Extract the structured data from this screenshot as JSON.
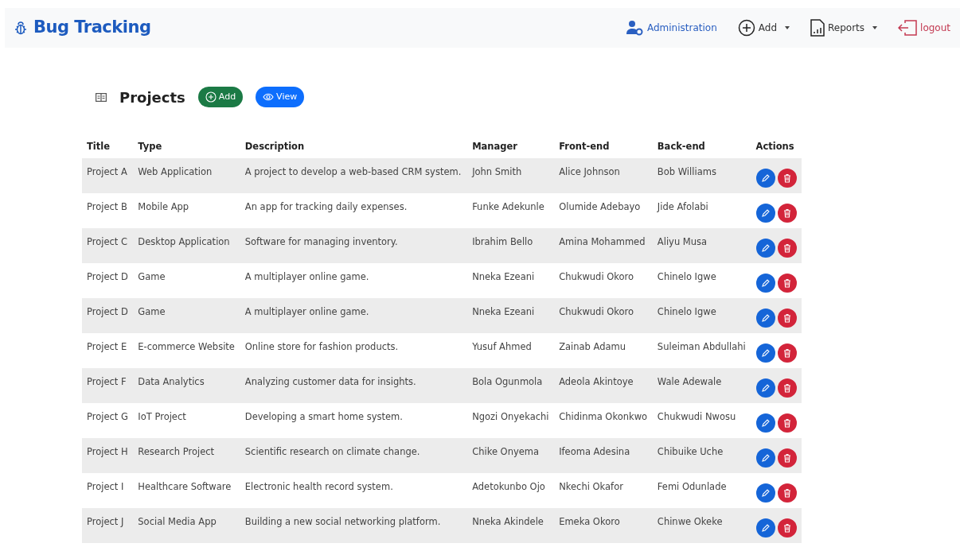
{
  "brand": "Bug Tracking",
  "nav": [
    {
      "label": "Administration",
      "kind": "link"
    },
    {
      "label": "Add",
      "kind": "dropdown"
    },
    {
      "label": "Reports",
      "kind": "dropdown"
    },
    {
      "label": "logout",
      "kind": "logout"
    }
  ],
  "page": {
    "title": "Projects",
    "buttons": [
      {
        "label": "Add",
        "kind": "success"
      },
      {
        "label": "View",
        "kind": "primary"
      }
    ]
  },
  "table": {
    "columns": [
      "Title",
      "Type",
      "Description",
      "Manager",
      "Front-end",
      "Back-end",
      "Actions"
    ],
    "rows": [
      [
        "Project A",
        "Web Application",
        "A project to develop a web-based CRM system.",
        "John Smith",
        "Alice Johnson",
        "Bob Williams"
      ],
      [
        "Project B",
        "Mobile App",
        "An app for tracking daily expenses.",
        "Funke Adekunle",
        "Olumide Adebayo",
        "Jide Afolabi"
      ],
      [
        "Project C",
        "Desktop Application",
        "Software for managing inventory.",
        "Ibrahim Bello",
        "Amina Mohammed",
        "Aliyu Musa"
      ],
      [
        "Project D",
        "Game",
        "A multiplayer online game.",
        "Nneka Ezeani",
        "Chukwudi Okoro",
        "Chinelo Igwe"
      ],
      [
        "Project D",
        "Game",
        "A multiplayer online game.",
        "Nneka Ezeani",
        "Chukwudi Okoro",
        "Chinelo Igwe"
      ],
      [
        "Project E",
        "E-commerce Website",
        "Online store for fashion products.",
        "Yusuf Ahmed",
        "Zainab Adamu",
        "Suleiman Abdullahi"
      ],
      [
        "Project F",
        "Data Analytics",
        "Analyzing customer data for insights.",
        "Bola Ogunmola",
        "Adeola Akintoye",
        "Wale Adewale"
      ],
      [
        "Project G",
        "IoT Project",
        "Developing a smart home system.",
        "Ngozi Onyekachi",
        "Chidinma Okonkwo",
        "Chukwudi Nwosu"
      ],
      [
        "Project H",
        "Research Project",
        "Scientific research on climate change.",
        "Chike Onyema",
        "Ifeoma Adesina",
        "Chibuike Uche"
      ],
      [
        "Project I",
        "Healthcare Software",
        "Electronic health record system.",
        "Adetokunbo Ojo",
        "Nkechi Okafor",
        "Femi Odunlade"
      ],
      [
        "Project J",
        "Social Media App",
        "Building a new social networking platform.",
        "Nneka Akindele",
        "Emeka Okoro",
        "Chinwe Okeke"
      ]
    ]
  }
}
